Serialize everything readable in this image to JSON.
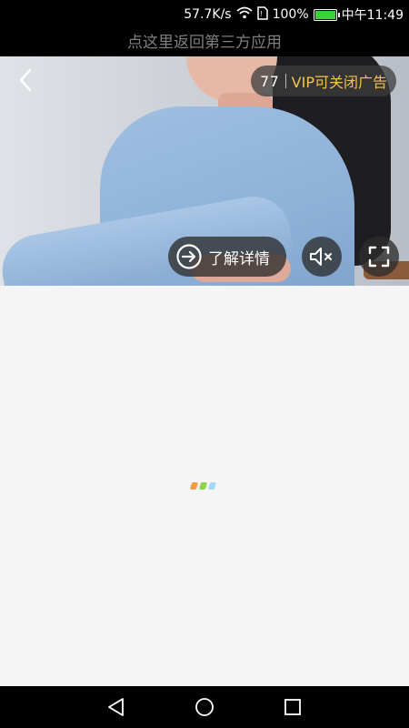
{
  "status_bar": {
    "network_speed": "57.7K/s",
    "battery_percent": "100%",
    "battery_level": 1.0,
    "time": "中午11:49",
    "icons": [
      "wifi-icon",
      "sim-icon",
      "battery-icon"
    ]
  },
  "return_bar": {
    "text": "点这里返回第三方应用"
  },
  "ad": {
    "countdown": "77",
    "vip_close_label": "VIP可关闭广告",
    "detail_label": "了解详情",
    "icons": [
      "back-arrow-icon",
      "arrow-circle-icon",
      "mute-icon",
      "fullscreen-icon"
    ]
  },
  "loading": {
    "colors": [
      "#f29a4a",
      "#8fd14f",
      "#a6d8f5"
    ]
  },
  "nav_bar": {
    "icons": [
      "back-triangle-icon",
      "home-circle-icon",
      "recents-square-icon"
    ]
  },
  "colors": {
    "vip_accent": "#f5c24b"
  }
}
